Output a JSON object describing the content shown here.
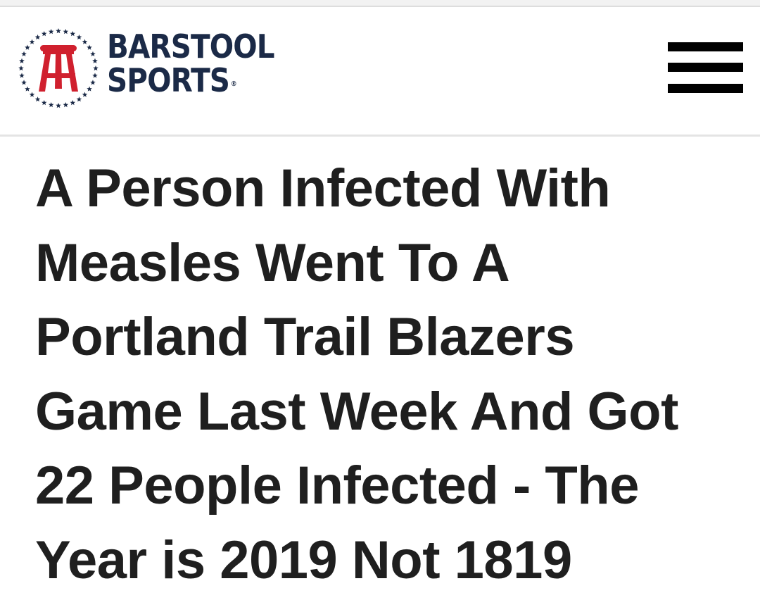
{
  "header": {
    "logo": {
      "line1": "BARSTOOL",
      "line2": "SPORTS",
      "registered_mark": "®",
      "emblem_icon": "barstool-stool-emblem-icon",
      "colors": {
        "navy": "#1b2a47",
        "red": "#d0202e"
      }
    },
    "menu_icon": "hamburger-menu-icon"
  },
  "article": {
    "headline": "A Person Infected With Measles Went To A Portland Trail Blazers Game Last Week And Got 22 People Infected - The Year is 2019 Not 1819"
  }
}
